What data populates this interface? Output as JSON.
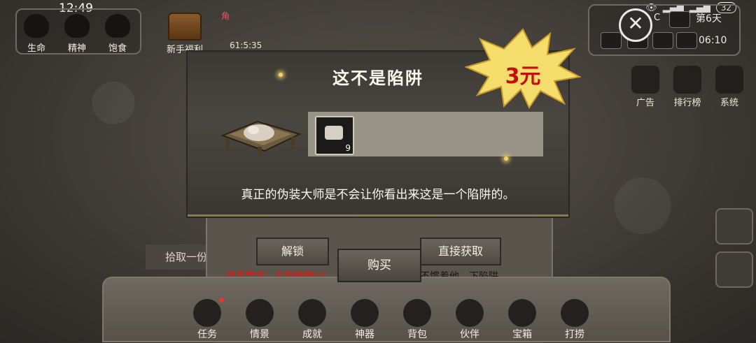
{
  "status_bar": {
    "time": "12:49",
    "battery": "32"
  },
  "stats": [
    {
      "label": "生命"
    },
    {
      "label": "精神"
    },
    {
      "label": "饱食"
    }
  ],
  "welfare": {
    "label": "新手福利",
    "corner": "角",
    "timer": "61:5:35"
  },
  "top_right": {
    "day": "第6天",
    "clock": "06:10",
    "temp_suffix": "C"
  },
  "right_icons": [
    {
      "label": "广告"
    },
    {
      "label": "排行榜"
    },
    {
      "label": "系统"
    }
  ],
  "back_dialog": {
    "unlock": "解锁",
    "direct_get": "直接获取",
    "requirement": "道具需求：五彩辣椒(0",
    "hint": "不惯着他，下陷阱",
    "pickup": "拾取一份"
  },
  "modal": {
    "title": "这不是陷阱",
    "item_count": "9",
    "description": "真正的伪装大师是不会让你看出来这是一个陷阱的。"
  },
  "price": "3元",
  "buy_label": "购买",
  "nav": [
    {
      "label": "任务",
      "dot": true
    },
    {
      "label": "情景"
    },
    {
      "label": "成就"
    },
    {
      "label": "神器"
    },
    {
      "label": "背包"
    },
    {
      "label": "伙伴"
    },
    {
      "label": "宝箱"
    },
    {
      "label": "打捞"
    }
  ]
}
